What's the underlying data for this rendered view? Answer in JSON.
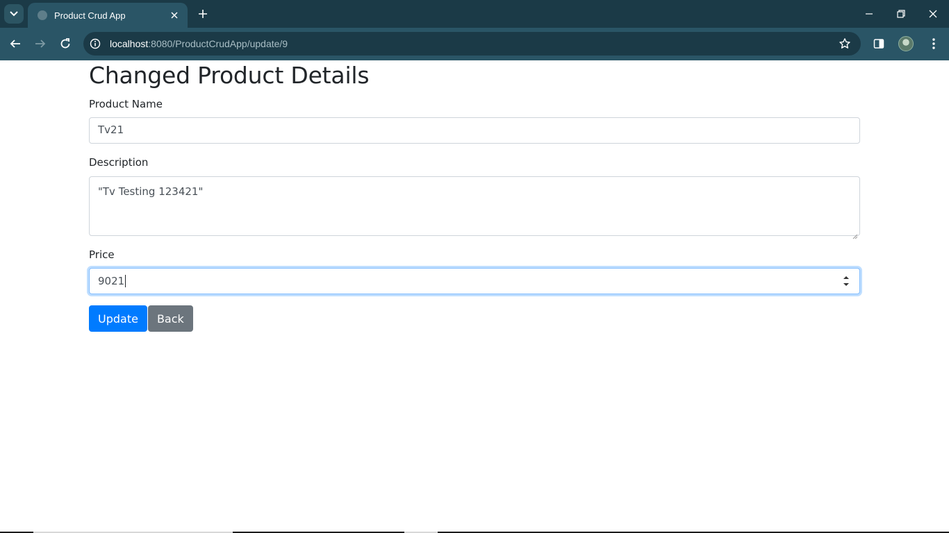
{
  "browser": {
    "tab_title": "Product Crud App",
    "url_host": "localhost",
    "url_path": ":8080/ProductCrudApp/update/9"
  },
  "page": {
    "heading": "Changed Product Details",
    "fields": {
      "name_label": "Product Name",
      "name_value": "Tv21",
      "description_label": "Description",
      "description_value": "\"Tv Testing 123421\"",
      "price_label": "Price",
      "price_value": "9021"
    },
    "buttons": {
      "update_label": "Update",
      "back_label": "Back"
    }
  },
  "colors": {
    "primary": "#007bff",
    "secondary": "#6c757d",
    "chrome_dark": "#1b3a47",
    "chrome_toolbar": "#2a5566"
  },
  "icons": [
    "tab-search-icon",
    "favicon-globe-icon",
    "close-icon",
    "plus-icon",
    "minimize-icon",
    "restore-icon",
    "window-close-icon",
    "back-arrow-icon",
    "forward-arrow-icon",
    "reload-icon",
    "site-info-icon",
    "bookmark-star-icon",
    "side-panel-icon",
    "profile-avatar-icon",
    "kebab-menu-icon",
    "spinner-icon"
  ]
}
